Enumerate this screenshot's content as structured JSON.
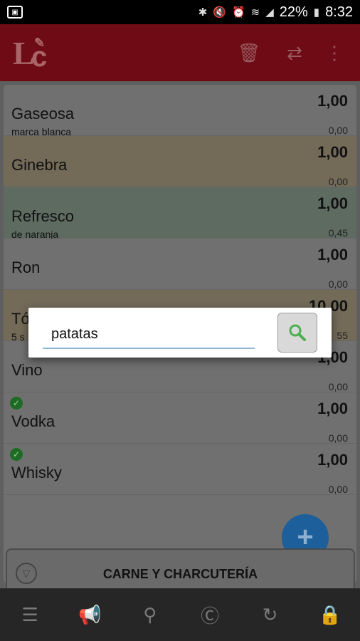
{
  "status_bar": {
    "battery": "22%",
    "time": "8:32"
  },
  "app_bar": {
    "logo_letters": [
      "L",
      "c"
    ]
  },
  "items": [
    {
      "name": "Gaseosa",
      "subtitle": "marca blanca",
      "qty": "1,00",
      "price": "0,00",
      "bg": "#707070",
      "checked": false
    },
    {
      "name": "Ginebra",
      "subtitle": "",
      "qty": "1,00",
      "price": "0,00",
      "bg": "#736a58",
      "checked": false
    },
    {
      "name": "Refresco",
      "subtitle": "de naranja",
      "qty": "1,00",
      "price": "0,45",
      "bg": "#5e6b61",
      "checked": false
    },
    {
      "name": "Ron",
      "subtitle": "",
      "qty": "1,00",
      "price": "0,00",
      "bg": "#707070",
      "checked": false
    },
    {
      "name": "Tó",
      "subtitle": "5 s",
      "qty": "10,00",
      "price": "55",
      "bg": "#736a58",
      "checked": false
    },
    {
      "name": "Vino",
      "subtitle": "",
      "qty": "1,00",
      "price": "0,00",
      "bg": "#707070",
      "checked": false
    },
    {
      "name": "Vodka",
      "subtitle": "",
      "qty": "1,00",
      "price": "0,00",
      "bg": "#707070",
      "checked": true
    },
    {
      "name": "Whisky",
      "subtitle": "",
      "qty": "1,00",
      "price": "0,00",
      "bg": "#707070",
      "checked": true
    }
  ],
  "category": {
    "label": "CARNE Y CHARCUTERÍA"
  },
  "search_dialog": {
    "value": "patatas",
    "accent": "#8fb6d3",
    "button_icon": "magnifier-icon",
    "button_icon_color": "#4caf50"
  },
  "fab": {
    "label": "+",
    "color": "#1c5f9a"
  },
  "bottom_bar": {
    "icons": [
      "list-icon",
      "megaphone-icon",
      "search-icon",
      "coupon-icon",
      "refresh-icon",
      "lock-icon"
    ]
  }
}
